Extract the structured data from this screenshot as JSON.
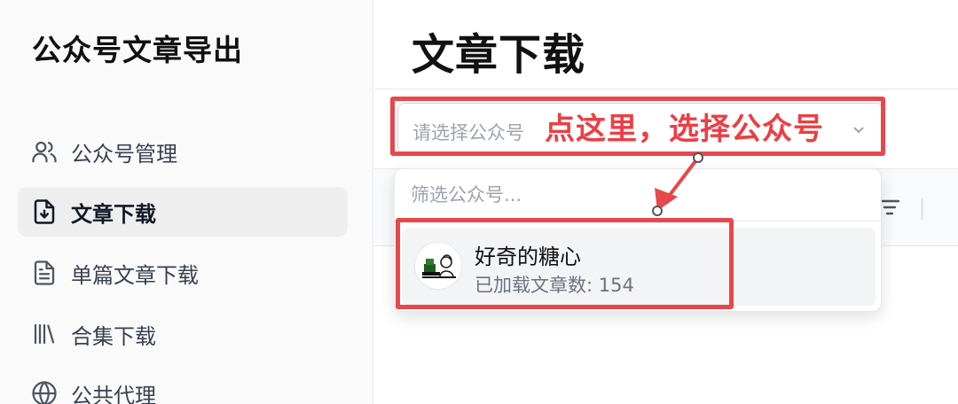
{
  "app_title": "公众号文章导出",
  "sidebar": {
    "items": [
      {
        "label": "公众号管理",
        "icon": "users-icon"
      },
      {
        "label": "文章下载",
        "icon": "file-download-icon",
        "active": true
      },
      {
        "label": "单篇文章下载",
        "icon": "file-text-icon"
      },
      {
        "label": "合集下载",
        "icon": "library-icon"
      },
      {
        "label": "公共代理",
        "icon": "globe-icon"
      }
    ]
  },
  "main": {
    "title": "文章下载",
    "select": {
      "placeholder": "请选择公众号"
    },
    "dropdown": {
      "search_placeholder": "筛选公众号...",
      "options": [
        {
          "name": "好奇的糖心",
          "count_text": "已加载文章数: 154"
        }
      ]
    }
  },
  "annotation": {
    "text": "点这里，选择公众号",
    "color": "#e8474b"
  },
  "colors": {
    "active_bg": "#eeeeee",
    "annotation_red": "#e8474b",
    "muted_text": "#9ca3af"
  }
}
